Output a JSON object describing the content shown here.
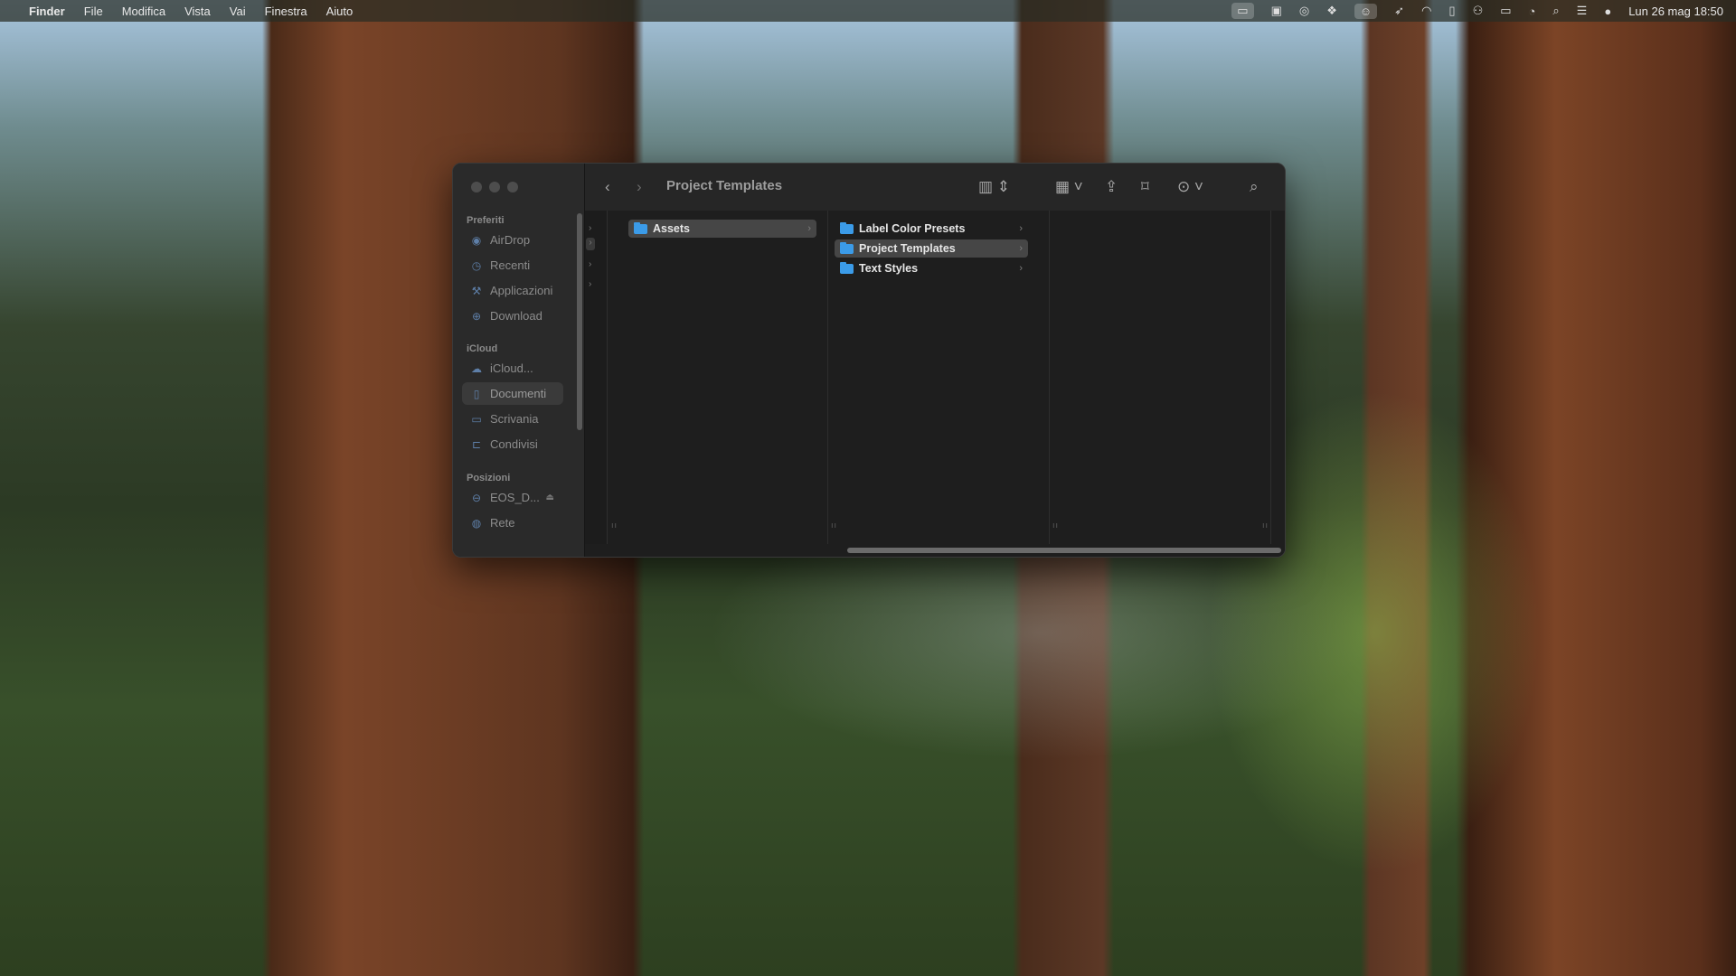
{
  "menubar": {
    "app": "Finder",
    "items": [
      "File",
      "Modifica",
      "Vista",
      "Vai",
      "Finestra",
      "Aiuto"
    ],
    "datetime": "Lun 26 mag  18:50",
    "status_icons": [
      "display-icon",
      "screenshot-icon",
      "creative-cloud-icon",
      "dropbox-icon",
      "finder-status-icon",
      "bird-icon",
      "airdrop-status-icon",
      "document-icon",
      "network-icon",
      "battery-icon",
      "wifi-icon",
      "spotlight-icon",
      "control-center-icon",
      "siri-icon"
    ]
  },
  "window": {
    "title": "Project Templates",
    "sidebar": {
      "sections": [
        {
          "title": "Preferiti",
          "items": [
            {
              "label": "AirDrop",
              "icon": "airdrop-icon"
            },
            {
              "label": "Recenti",
              "icon": "clock-icon"
            },
            {
              "label": "Applicazioni",
              "icon": "applications-icon"
            },
            {
              "label": "Download",
              "icon": "download-icon"
            }
          ]
        },
        {
          "title": "iCloud",
          "items": [
            {
              "label": "iCloud...",
              "icon": "cloud-icon"
            },
            {
              "label": "Documenti",
              "icon": "document-icon",
              "selected": true
            },
            {
              "label": "Scrivania",
              "icon": "desktop-icon"
            },
            {
              "label": "Condivisi",
              "icon": "shared-folder-icon"
            }
          ]
        },
        {
          "title": "Posizioni",
          "items": [
            {
              "label": "EOS_D...",
              "icon": "disk-icon",
              "eject": true
            },
            {
              "label": "Rete",
              "icon": "network-globe-icon"
            }
          ]
        }
      ]
    },
    "columns": [
      {
        "items": [
          {
            "label": "Assets",
            "selected": true
          }
        ]
      },
      {
        "items": [
          {
            "label": "Label Color Presets"
          },
          {
            "label": "Project Templates",
            "selected": true
          },
          {
            "label": "Text Styles"
          }
        ]
      },
      {
        "items": []
      }
    ]
  },
  "colors": {
    "folder": "#3b9be8",
    "selection": "#464646",
    "window_bg": "#1e1e1e"
  }
}
